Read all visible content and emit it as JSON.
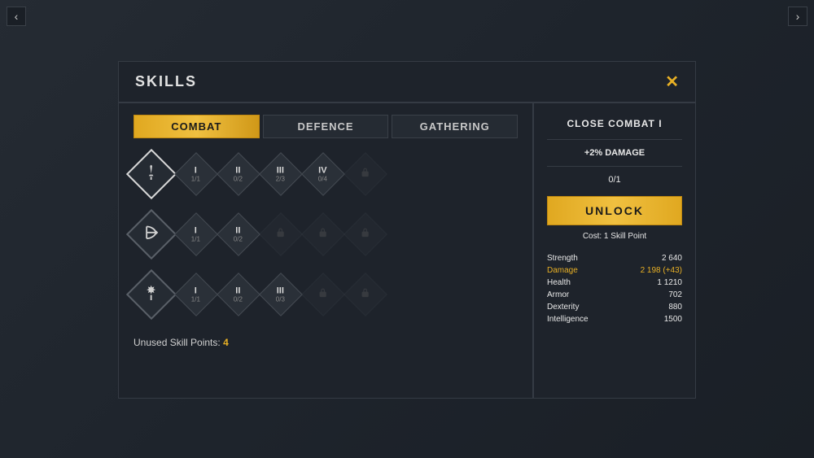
{
  "title": "SKILLS",
  "tabs": [
    "COMBAT",
    "DEFENCE",
    "GATHERING"
  ],
  "rows": [
    {
      "icon": "sword",
      "nodes": [
        {
          "num": "I",
          "prog": "1/1"
        },
        {
          "num": "II",
          "prog": "0/2"
        },
        {
          "num": "III",
          "prog": "2/3"
        },
        {
          "num": "IV",
          "prog": "0/4"
        },
        {
          "locked": true
        }
      ]
    },
    {
      "icon": "bow",
      "nodes": [
        {
          "num": "I",
          "prog": "1/1"
        },
        {
          "num": "II",
          "prog": "0/2"
        },
        {
          "locked": true
        },
        {
          "locked": true
        },
        {
          "locked": true
        }
      ]
    },
    {
      "icon": "wand",
      "nodes": [
        {
          "num": "I",
          "prog": "1/1"
        },
        {
          "num": "II",
          "prog": "0/2"
        },
        {
          "num": "III",
          "prog": "0/3"
        },
        {
          "locked": true
        },
        {
          "locked": true
        }
      ]
    }
  ],
  "footer_label": "Unused Skill Points: ",
  "footer_value": "4",
  "detail": {
    "name": "CLOSE COMBAT I",
    "effect": "+2% DAMAGE",
    "prog": "0/1",
    "unlock": "UNLOCK",
    "cost": "Cost: 1 Skill Point",
    "stats": [
      {
        "l": "Strength",
        "v": "2 640"
      },
      {
        "l": "Damage",
        "v": "2 198 (+43)",
        "hl": true
      },
      {
        "l": "Health",
        "v": "1 1210"
      },
      {
        "l": "Armor",
        "v": "702"
      },
      {
        "l": "Dexterity",
        "v": "880"
      },
      {
        "l": "Intelligence",
        "v": "1500"
      }
    ]
  }
}
